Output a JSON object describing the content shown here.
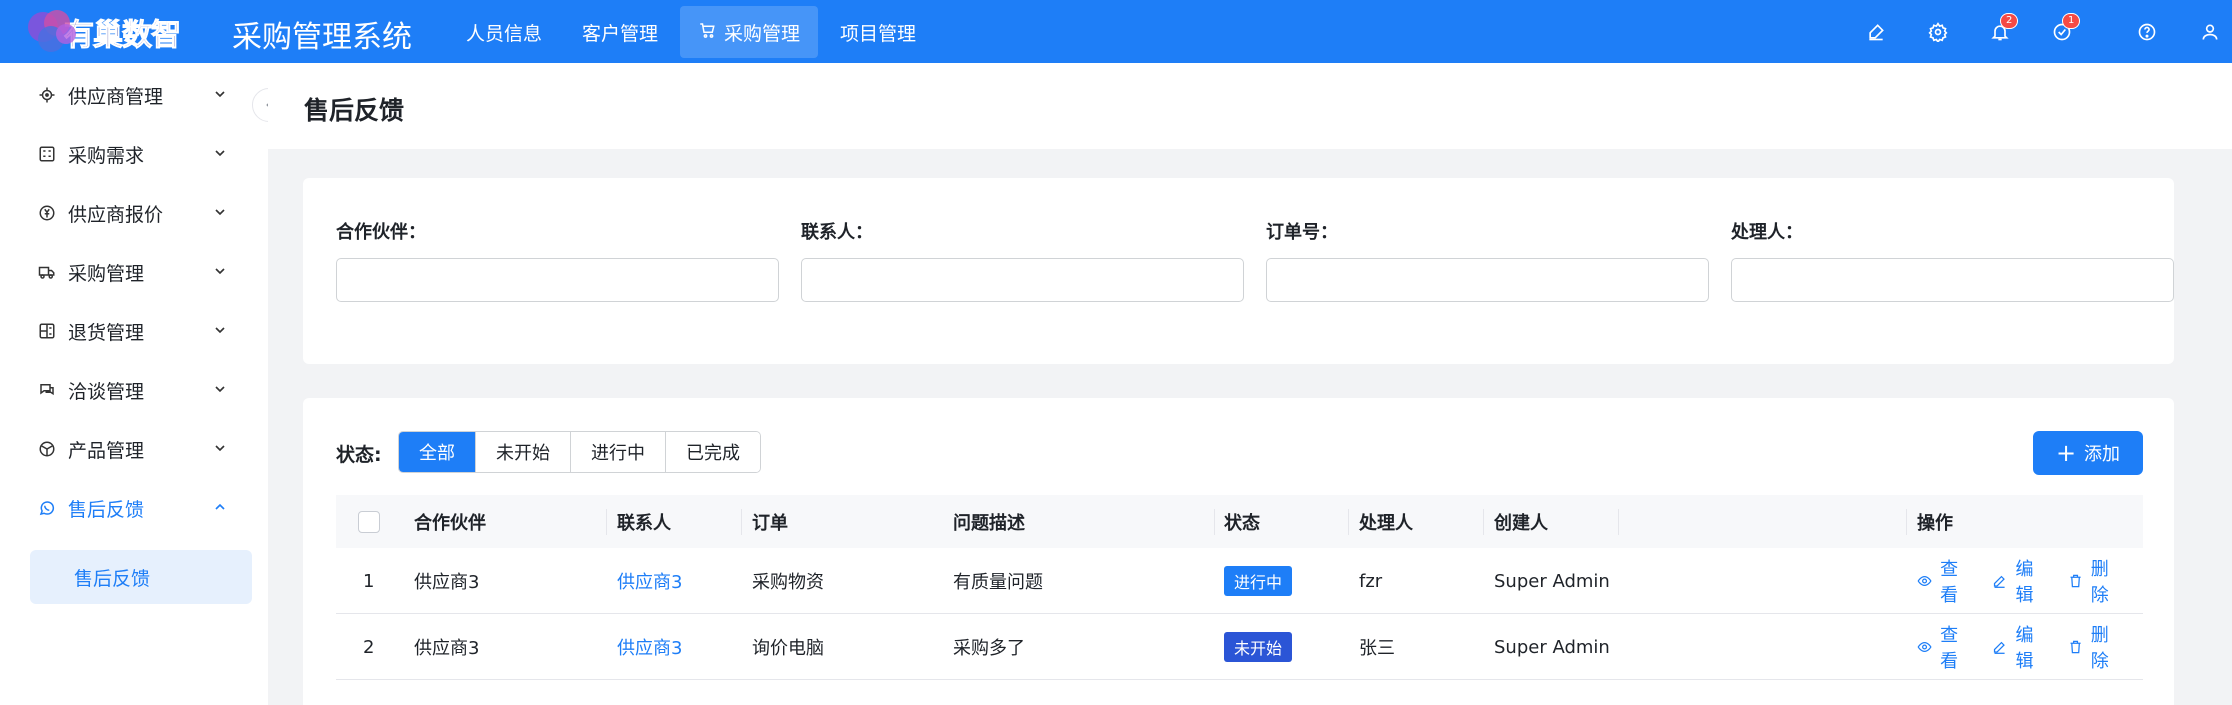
{
  "header": {
    "logo_text": "有巢数智",
    "system_title": "采购管理系统",
    "nav": [
      {
        "label": "人员信息"
      },
      {
        "label": "客户管理"
      },
      {
        "label": "采购管理"
      },
      {
        "label": "项目管理"
      }
    ],
    "notification_count": "2",
    "todo_count": "1"
  },
  "sidebar": {
    "items": [
      {
        "label": "供应商管理",
        "icon": "target-icon"
      },
      {
        "label": "采购需求",
        "icon": "grid-icon"
      },
      {
        "label": "供应商报价",
        "icon": "price-icon"
      },
      {
        "label": "采购管理",
        "icon": "truck-icon"
      },
      {
        "label": "退货管理",
        "icon": "return-icon"
      },
      {
        "label": "洽谈管理",
        "icon": "chat-icon"
      },
      {
        "label": "产品管理",
        "icon": "product-icon"
      },
      {
        "label": "售后反馈",
        "icon": "whatsapp-icon"
      }
    ],
    "sub_item": "售后反馈"
  },
  "page": {
    "title": "售后反馈"
  },
  "filters": [
    {
      "label": "合作伙伴：",
      "value": ""
    },
    {
      "label": "联系人：",
      "value": ""
    },
    {
      "label": "订单号：",
      "value": ""
    },
    {
      "label": "处理人：",
      "value": ""
    }
  ],
  "status_filter": {
    "label": "状态:",
    "options": [
      "全部",
      "未开始",
      "进行中",
      "已完成"
    ],
    "selected": "全部"
  },
  "add_button": "添加",
  "table": {
    "columns": [
      "合作伙伴",
      "联系人",
      "订单",
      "问题描述",
      "状态",
      "处理人",
      "创建人",
      "操作"
    ],
    "actions": [
      "查看",
      "编辑",
      "删除"
    ],
    "rows": [
      {
        "index": "1",
        "partner": "供应商3",
        "contact": "供应商3",
        "order": "采购物资",
        "issue": "有质量问题",
        "status": "进行中",
        "status_color": "#1e7ef7",
        "handler": "fzr",
        "creator": "Super Admin"
      },
      {
        "index": "2",
        "partner": "供应商3",
        "contact": "供应商3",
        "order": "询价电脑",
        "issue": "采购多了",
        "status": "未开始",
        "status_color": "#2b55d6",
        "handler": "张三",
        "creator": "Super Admin"
      }
    ]
  },
  "colors": {
    "primary": "#1e7ef7",
    "header_bg": "#1e7ef7",
    "badge": "#f54a45"
  }
}
